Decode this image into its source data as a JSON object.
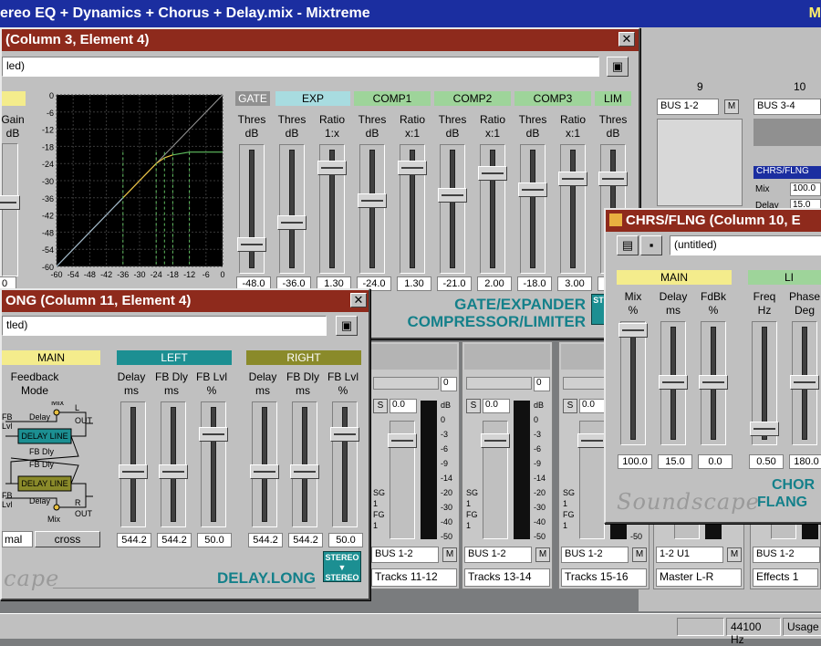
{
  "app": {
    "title": "ereo EQ + Dynamics + Chorus + Delay.mix - Mixtreme",
    "title_right": "M"
  },
  "mixer": {
    "columns": [
      "9",
      "10"
    ],
    "bus_labels": [
      "BUS 1-2",
      "BUS 3-4"
    ],
    "m_label": "M",
    "chrs_title": "CHRS/FLNG",
    "chrs_rows": [
      {
        "label": "Mix",
        "value": "100.0"
      },
      {
        "label": "Delay",
        "value": "15.0"
      }
    ],
    "strips": [
      {
        "fader_val": "0",
        "pan_val": "0.0",
        "bus": "BUS 1-2",
        "name": "Tracks 11-12"
      },
      {
        "fader_val": "0",
        "pan_val": "0.0",
        "bus": "BUS 1-2",
        "name": "Tracks 13-14"
      },
      {
        "fader_val": "0",
        "pan_val": "0.0",
        "bus": "BUS 1-2",
        "name": "Tracks 15-16"
      },
      {
        "fader_val": "",
        "pan_val": "",
        "bus": "1-2 U1",
        "name": "Master L-R"
      },
      {
        "fader_val": "",
        "pan_val": "",
        "bus": "BUS 1-2",
        "name": "Effects 1"
      }
    ],
    "meter_scale": [
      "dB",
      "0",
      "-3",
      "-6",
      "-9",
      "-14",
      "-20",
      "-30",
      "-40",
      "-50"
    ],
    "strip_small": [
      "SG",
      "1",
      "FG",
      "1"
    ],
    "chrs_strip_small": [
      "2",
      "-50"
    ]
  },
  "gate_window": {
    "title": "(Column 3, Element 4)",
    "file": "led)",
    "left_partial": {
      "header": "",
      "label": "Gain",
      "unit": "dB",
      "value": "0"
    },
    "graph": {
      "y_ticks": [
        "0",
        "-6",
        "-12",
        "-18",
        "-24",
        "-30",
        "-36",
        "-42",
        "-48",
        "-54",
        "-60"
      ],
      "x_ticks": [
        "-60",
        "-54",
        "-48",
        "-42",
        "-36",
        "-30",
        "-24",
        "-18",
        "-12",
        "-6",
        "0"
      ]
    },
    "sections": [
      {
        "name": "GATE",
        "color": "#909090",
        "text_color": "#ffffff"
      },
      {
        "name": "EXP",
        "color": "#a8dce0",
        "text_color": "#000000"
      },
      {
        "name": "COMP1",
        "color": "#9ed49a",
        "text_color": "#000000"
      },
      {
        "name": "COMP2",
        "color": "#9ed49a",
        "text_color": "#000000"
      },
      {
        "name": "COMP3",
        "color": "#9ed49a",
        "text_color": "#000000"
      },
      {
        "name": "LIM",
        "color": "#9ed49a",
        "text_color": "#000000"
      }
    ],
    "faders": [
      {
        "label": "Thres",
        "unit": "dB",
        "value": "-48.0",
        "level": 0.8
      },
      {
        "label": "Thres",
        "unit": "dB",
        "value": "-36.0",
        "level": 0.6
      },
      {
        "label": "Ratio",
        "unit": "1:x",
        "value": "1.30",
        "level": 0.1
      },
      {
        "label": "Thres",
        "unit": "dB",
        "value": "-24.0",
        "level": 0.4
      },
      {
        "label": "Ratio",
        "unit": "x:1",
        "value": "1.30",
        "level": 0.1
      },
      {
        "label": "Thres",
        "unit": "dB",
        "value": "-21.0",
        "level": 0.35
      },
      {
        "label": "Ratio",
        "unit": "x:1",
        "value": "2.00",
        "level": 0.15
      },
      {
        "label": "Thres",
        "unit": "dB",
        "value": "-18.0",
        "level": 0.3
      },
      {
        "label": "Ratio",
        "unit": "x:1",
        "value": "3.00",
        "level": 0.2
      },
      {
        "label": "Thres",
        "unit": "dB",
        "value": "",
        "level": 0.2
      }
    ],
    "name_line1": "GATE/EXPANDER",
    "name_line2": "COMPRESSOR/LIMITER",
    "stereo_badge": "ST"
  },
  "delay_window": {
    "title": "ONG (Column 11, Element 4)",
    "file": "tled)",
    "sections": [
      {
        "name": "MAIN",
        "color": "#f4ec8c",
        "text_color": "#000000"
      },
      {
        "name": "LEFT",
        "color": "#1c8f92",
        "text_color": "#ffffff"
      },
      {
        "name": "RIGHT",
        "color": "#8a8a2a",
        "text_color": "#ffffff"
      }
    ],
    "mode_label": "Feedback",
    "mode_label2": "Mode",
    "diagram": {
      "mix_top": "Mix",
      "l_out": "L",
      "out1": "OUT",
      "fb1": "FB",
      "lvl1": "Lvl",
      "delay1": "Delay",
      "box1": "DELAY LINE",
      "fbdly1": "FB Dly",
      "fbdly2": "FB Dly",
      "box2": "DELAY LINE",
      "fb2": "FB",
      "lvl2": "Lvl",
      "delay2": "Delay",
      "r_out": "R",
      "out2": "OUT",
      "mix_bot": "Mix"
    },
    "mode_buttons": [
      "mal",
      "cross"
    ],
    "faders": [
      {
        "label": "Delay",
        "unit": "ms",
        "value": "544.2",
        "level": 0.55
      },
      {
        "label": "FB Dly",
        "unit": "ms",
        "value": "544.2",
        "level": 0.55
      },
      {
        "label": "FB Lvl",
        "unit": "%",
        "value": "50.0",
        "level": 0.2
      },
      {
        "label": "Delay",
        "unit": "ms",
        "value": "544.2",
        "level": 0.55
      },
      {
        "label": "FB Dly",
        "unit": "ms",
        "value": "544.2",
        "level": 0.55
      },
      {
        "label": "FB Lvl",
        "unit": "%",
        "value": "50.0",
        "level": 0.2
      }
    ],
    "name": "DELAY.LONG",
    "stereo_badge": "STEREO ▼ STEREO",
    "logo": "cape"
  },
  "chorus_window": {
    "title": "CHRS/FLNG (Column 10, E",
    "file": "(untitled)",
    "sections": [
      {
        "name": "MAIN",
        "color": "#f4ec8c",
        "text_color": "#000000"
      },
      {
        "name": "LI",
        "color": "#9ed49a",
        "text_color": "#000000"
      }
    ],
    "faders": [
      {
        "label": "Mix",
        "unit": "%",
        "value": "100.0",
        "level": 0.0
      },
      {
        "label": "Delay",
        "unit": "ms",
        "value": "15.0",
        "level": 0.5
      },
      {
        "label": "FdBk",
        "unit": "%",
        "value": "0.0",
        "level": 0.5
      },
      {
        "label": "Freq",
        "unit": "Hz",
        "value": "0.50",
        "level": 0.95
      },
      {
        "label": "Phase",
        "unit": "Deg",
        "value": "180.0",
        "level": 0.5
      }
    ],
    "name_line1": "CHOR",
    "name_line2": "FLANG",
    "logo": "Soundscape"
  },
  "status": {
    "rate": "44100 Hz",
    "usage": "Usage"
  }
}
